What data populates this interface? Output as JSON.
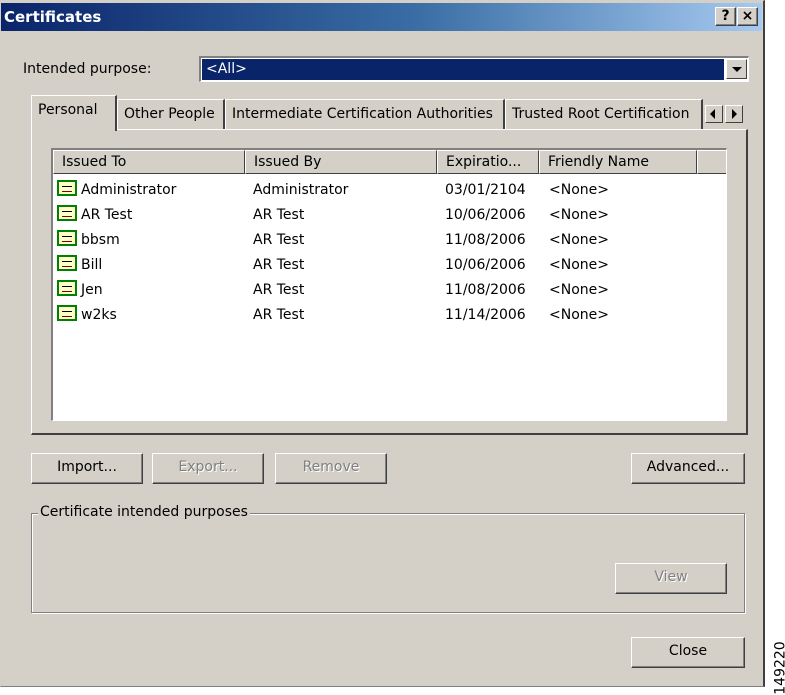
{
  "window": {
    "title": "Certificates",
    "help_button": "?",
    "close_button": "×"
  },
  "purpose": {
    "label": "Intended purpose:",
    "value": "<All>"
  },
  "tabs": [
    "Personal",
    "Other People",
    "Intermediate Certification Authorities",
    "Trusted Root Certification"
  ],
  "columns": [
    "Issued To",
    "Issued By",
    "Expiratio...",
    "Friendly Name"
  ],
  "certificates": [
    {
      "issued_to": "Administrator",
      "issued_by": "Administrator",
      "expiration": "03/01/2104",
      "friendly_name": "<None>"
    },
    {
      "issued_to": "AR Test",
      "issued_by": "AR Test",
      "expiration": "10/06/2006",
      "friendly_name": "<None>"
    },
    {
      "issued_to": "bbsm",
      "issued_by": "AR Test",
      "expiration": "11/08/2006",
      "friendly_name": "<None>"
    },
    {
      "issued_to": "Bill",
      "issued_by": "AR Test",
      "expiration": "10/06/2006",
      "friendly_name": "<None>"
    },
    {
      "issued_to": "Jen",
      "issued_by": "AR Test",
      "expiration": "11/08/2006",
      "friendly_name": "<None>"
    },
    {
      "issued_to": "w2ks",
      "issued_by": "AR Test",
      "expiration": "11/14/2006",
      "friendly_name": "<None>"
    }
  ],
  "buttons": {
    "import": "Import...",
    "export": "Export...",
    "remove": "Remove",
    "advanced": "Advanced...",
    "view": "View",
    "close": "Close"
  },
  "group": {
    "label": "Certificate intended purposes"
  },
  "figure_id": "149220",
  "icons": {
    "certificate": "certificate-icon",
    "dropdown": "chevron-down-icon",
    "scroll_left": "arrow-left-icon",
    "scroll_right": "arrow-right-icon"
  },
  "colors": {
    "title_start": "#0a246a",
    "title_end": "#a6caf0",
    "dialog_bg": "#d4d0c8",
    "selection": "#0a246a"
  }
}
